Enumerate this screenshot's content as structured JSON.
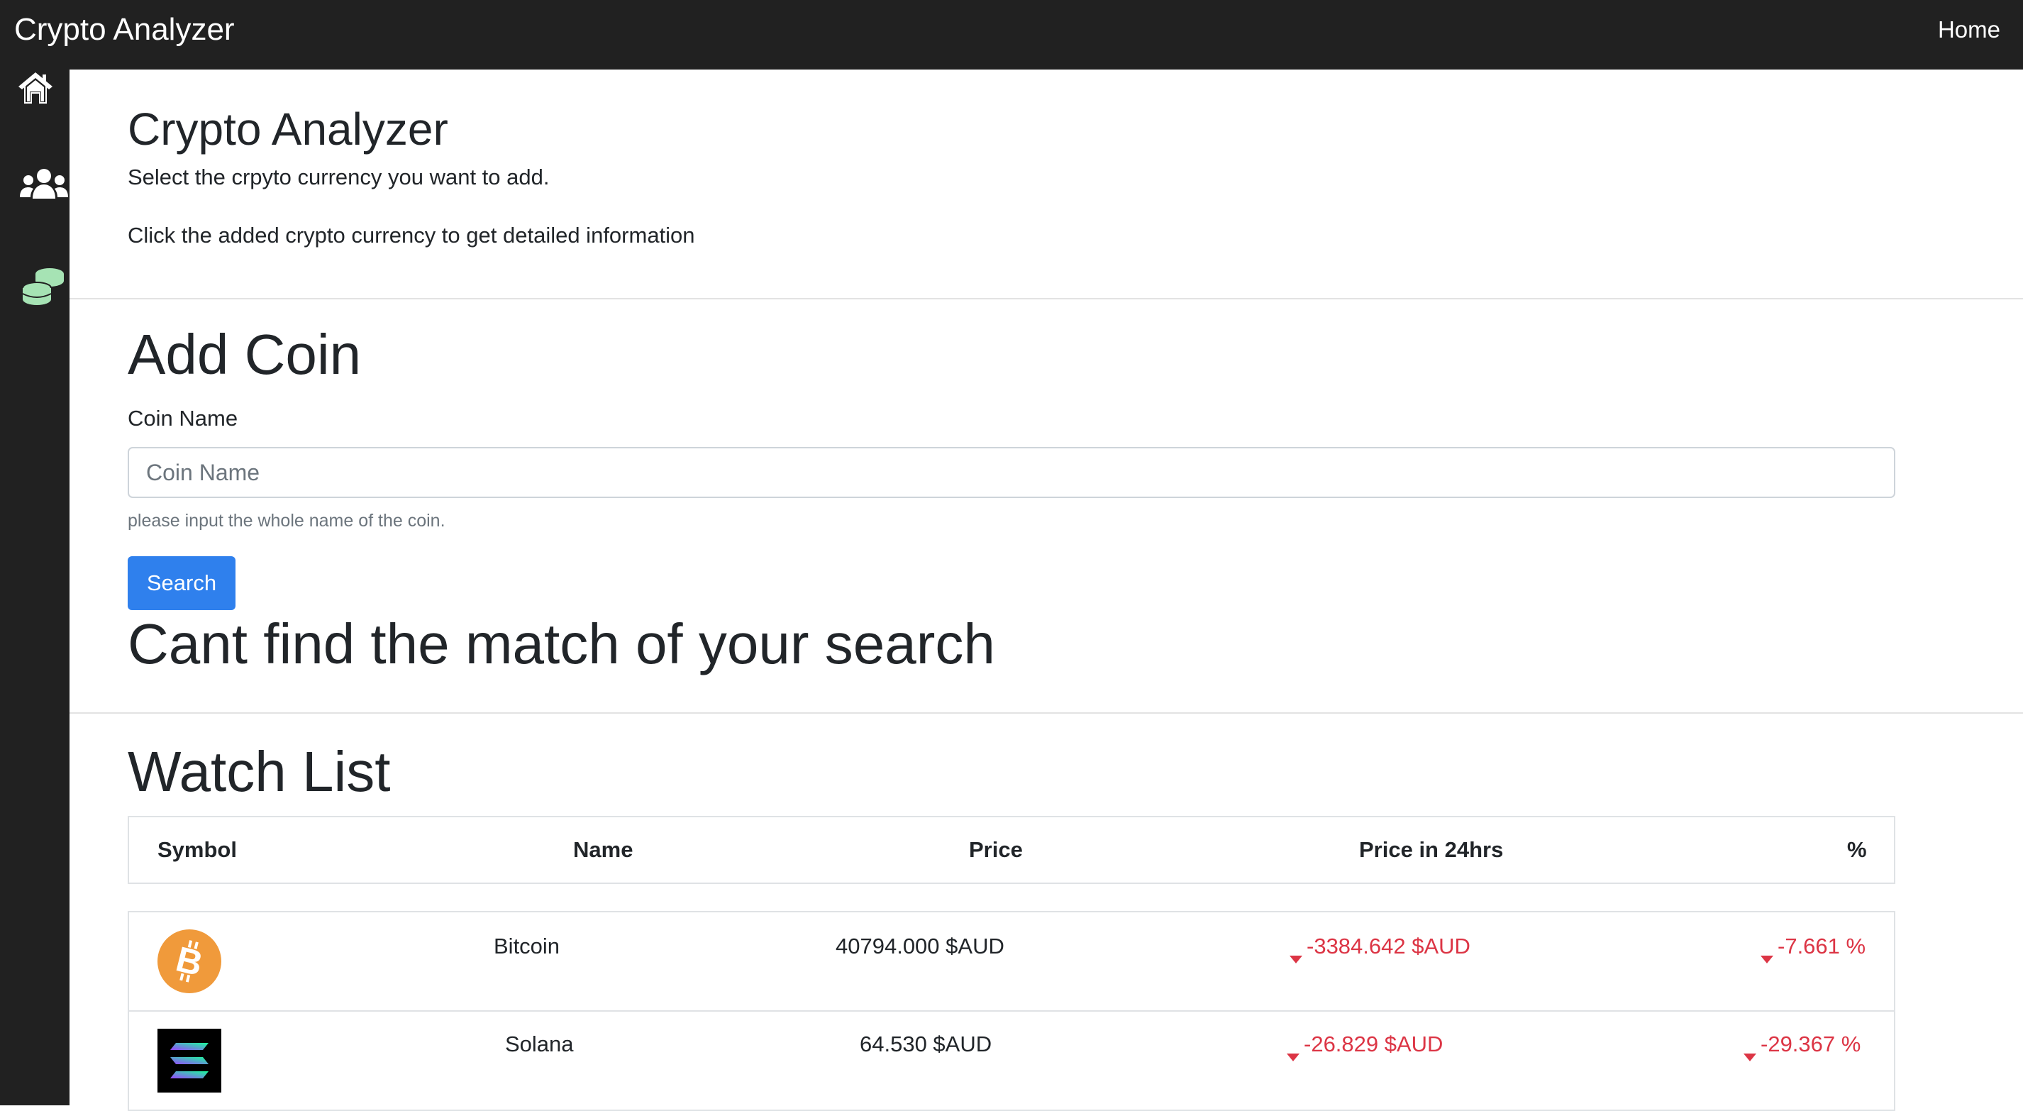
{
  "navbar": {
    "brand": "Crypto Analyzer",
    "home_link": "Home"
  },
  "sidebar": {
    "icons": [
      "home-icon",
      "users-icon",
      "coins-icon"
    ]
  },
  "intro": {
    "title": "Crypto Analyzer",
    "line1": "Select the crpyto currency you want to add.",
    "line2": "Click the added crypto currency to get detailed information"
  },
  "add_coin": {
    "heading": "Add Coin",
    "label": "Coin Name",
    "placeholder": "Coin Name",
    "value": "",
    "help": "please input the whole name of the coin.",
    "search_button": "Search",
    "no_match_message": "Cant find the match of your search"
  },
  "watch_list": {
    "heading": "Watch List",
    "columns": [
      "Symbol",
      "Name",
      "Price",
      "Price in 24hrs",
      "%"
    ],
    "rows": [
      {
        "icon": "bitcoin-icon",
        "name": "Bitcoin",
        "price": "40794.000 $AUD",
        "change": "-3384.642 $AUD",
        "percent": "-7.661 %"
      },
      {
        "icon": "solana-icon",
        "name": "Solana",
        "price": "64.530 $AUD",
        "change": "-26.829 $AUD",
        "percent": "-29.367 %"
      }
    ]
  },
  "colors": {
    "navbar": "#212121",
    "primary": "#2f80ed",
    "negative": "#dc3545",
    "bitcoin": "#f09a3b",
    "coins_icon": "#a6e3b4"
  }
}
